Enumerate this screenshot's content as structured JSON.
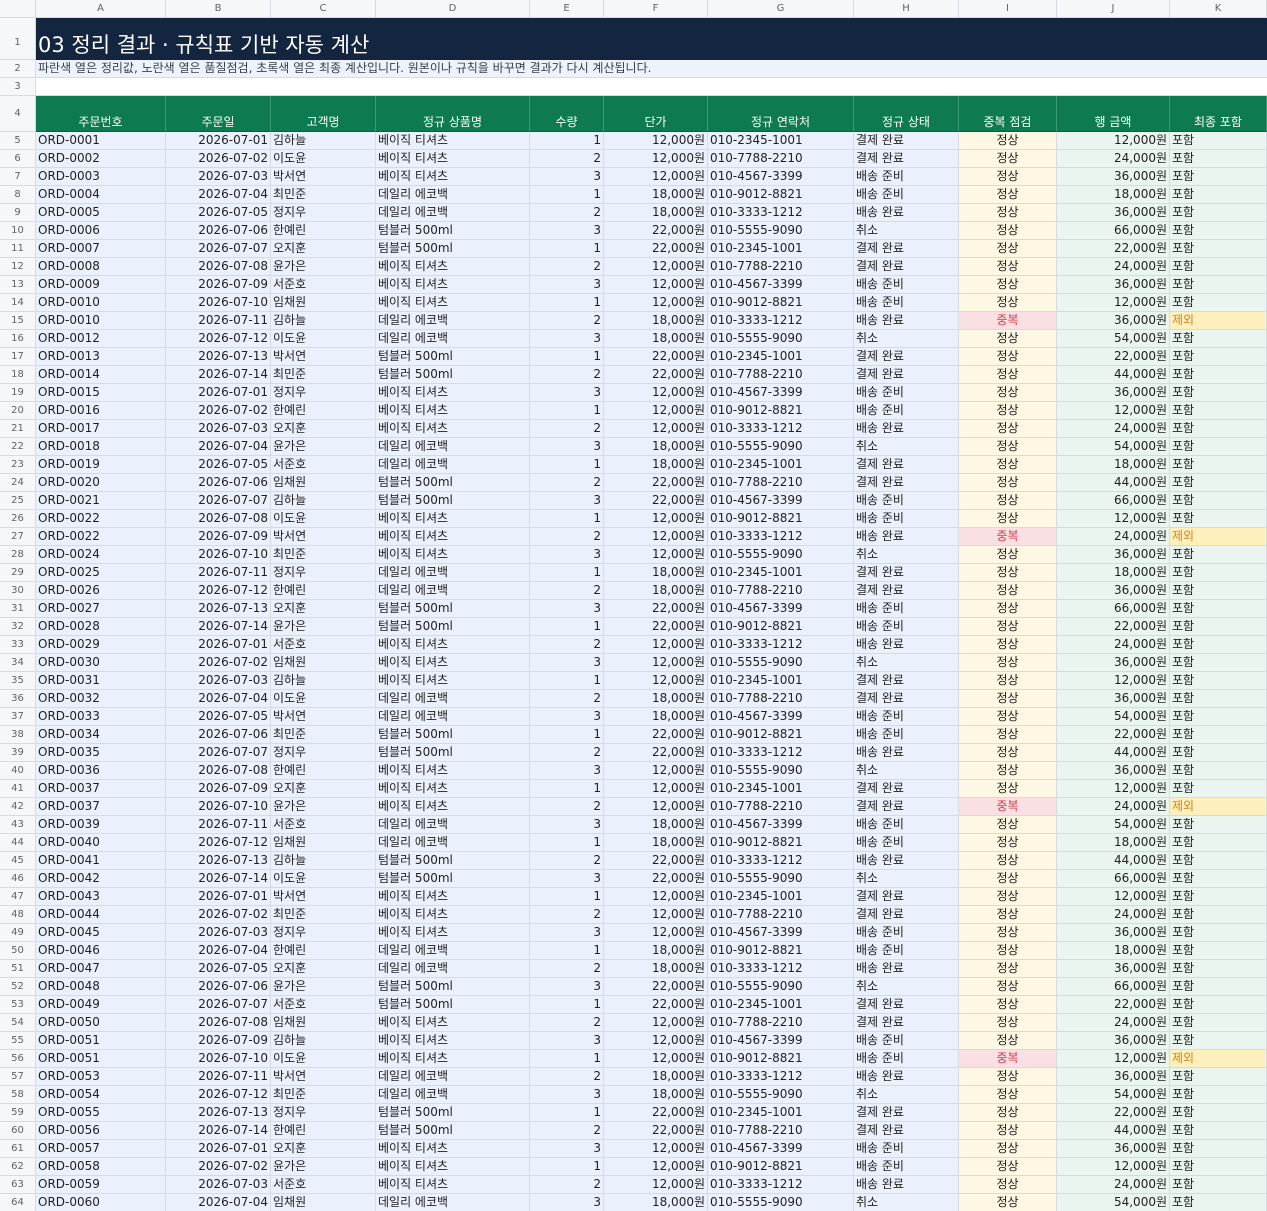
{
  "columns": [
    "A",
    "B",
    "C",
    "D",
    "E",
    "F",
    "G",
    "H",
    "I",
    "J",
    "K"
  ],
  "title": "03 정리 결과 · 규칙표 기반 자동 계산",
  "subtitle": "파란색 열은 정리값, 노란색 열은 품질점검, 초록색 열은 최종 계산입니다. 원본이나 규칙을 바꾸면 결과가 다시 계산됩니다.",
  "headers": [
    "주문번호",
    "주문일",
    "고객명",
    "정규 상품명",
    "수량",
    "단가",
    "정규 연락처",
    "정규 상태",
    "중복 점검",
    "행 금액",
    "최종 포함"
  ],
  "colors": {
    "title_bg": "#142540",
    "header_bg": "#0e7a4f",
    "clean_col": "#eaf1fc",
    "quality_col": "#fdf7e4",
    "final_col": "#e9f5ee",
    "dup_bg": "#fbe0e3",
    "dup_text": "#d23a4a",
    "excluded_bg": "#fdf0bd",
    "excluded_text": "#d5841a"
  },
  "rows": [
    {
      "order": "ORD-0001",
      "date": "2026-07-01",
      "customer": "김하늘",
      "product": "베이직 티셔츠",
      "qty": "1",
      "price": "12,000원",
      "phone": "010-2345-1001",
      "status": "결제 완료",
      "dup": "정상",
      "amount": "12,000원",
      "include": "포함"
    },
    {
      "order": "ORD-0002",
      "date": "2026-07-02",
      "customer": "이도윤",
      "product": "베이직 티셔츠",
      "qty": "2",
      "price": "12,000원",
      "phone": "010-7788-2210",
      "status": "결제 완료",
      "dup": "정상",
      "amount": "24,000원",
      "include": "포함"
    },
    {
      "order": "ORD-0003",
      "date": "2026-07-03",
      "customer": "박서연",
      "product": "베이직 티셔츠",
      "qty": "3",
      "price": "12,000원",
      "phone": "010-4567-3399",
      "status": "배송 준비",
      "dup": "정상",
      "amount": "36,000원",
      "include": "포함"
    },
    {
      "order": "ORD-0004",
      "date": "2026-07-04",
      "customer": "최민준",
      "product": "데일리 에코백",
      "qty": "1",
      "price": "18,000원",
      "phone": "010-9012-8821",
      "status": "배송 준비",
      "dup": "정상",
      "amount": "18,000원",
      "include": "포함"
    },
    {
      "order": "ORD-0005",
      "date": "2026-07-05",
      "customer": "정지우",
      "product": "데일리 에코백",
      "qty": "2",
      "price": "18,000원",
      "phone": "010-3333-1212",
      "status": "배송 완료",
      "dup": "정상",
      "amount": "36,000원",
      "include": "포함"
    },
    {
      "order": "ORD-0006",
      "date": "2026-07-06",
      "customer": "한예린",
      "product": "텀블러 500ml",
      "qty": "3",
      "price": "22,000원",
      "phone": "010-5555-9090",
      "status": "취소",
      "dup": "정상",
      "amount": "66,000원",
      "include": "포함"
    },
    {
      "order": "ORD-0007",
      "date": "2026-07-07",
      "customer": "오지훈",
      "product": "텀블러 500ml",
      "qty": "1",
      "price": "22,000원",
      "phone": "010-2345-1001",
      "status": "결제 완료",
      "dup": "정상",
      "amount": "22,000원",
      "include": "포함"
    },
    {
      "order": "ORD-0008",
      "date": "2026-07-08",
      "customer": "윤가은",
      "product": "베이직 티셔츠",
      "qty": "2",
      "price": "12,000원",
      "phone": "010-7788-2210",
      "status": "결제 완료",
      "dup": "정상",
      "amount": "24,000원",
      "include": "포함"
    },
    {
      "order": "ORD-0009",
      "date": "2026-07-09",
      "customer": "서준호",
      "product": "베이직 티셔츠",
      "qty": "3",
      "price": "12,000원",
      "phone": "010-4567-3399",
      "status": "배송 준비",
      "dup": "정상",
      "amount": "36,000원",
      "include": "포함"
    },
    {
      "order": "ORD-0010",
      "date": "2026-07-10",
      "customer": "임채원",
      "product": "베이직 티셔츠",
      "qty": "1",
      "price": "12,000원",
      "phone": "010-9012-8821",
      "status": "배송 준비",
      "dup": "정상",
      "amount": "12,000원",
      "include": "포함"
    },
    {
      "order": "ORD-0010",
      "date": "2026-07-11",
      "customer": "김하늘",
      "product": "데일리 에코백",
      "qty": "2",
      "price": "18,000원",
      "phone": "010-3333-1212",
      "status": "배송 완료",
      "dup": "중복",
      "amount": "36,000원",
      "include": "제외"
    },
    {
      "order": "ORD-0012",
      "date": "2026-07-12",
      "customer": "이도윤",
      "product": "데일리 에코백",
      "qty": "3",
      "price": "18,000원",
      "phone": "010-5555-9090",
      "status": "취소",
      "dup": "정상",
      "amount": "54,000원",
      "include": "포함"
    },
    {
      "order": "ORD-0013",
      "date": "2026-07-13",
      "customer": "박서연",
      "product": "텀블러 500ml",
      "qty": "1",
      "price": "22,000원",
      "phone": "010-2345-1001",
      "status": "결제 완료",
      "dup": "정상",
      "amount": "22,000원",
      "include": "포함"
    },
    {
      "order": "ORD-0014",
      "date": "2026-07-14",
      "customer": "최민준",
      "product": "텀블러 500ml",
      "qty": "2",
      "price": "22,000원",
      "phone": "010-7788-2210",
      "status": "결제 완료",
      "dup": "정상",
      "amount": "44,000원",
      "include": "포함"
    },
    {
      "order": "ORD-0015",
      "date": "2026-07-01",
      "customer": "정지우",
      "product": "베이직 티셔츠",
      "qty": "3",
      "price": "12,000원",
      "phone": "010-4567-3399",
      "status": "배송 준비",
      "dup": "정상",
      "amount": "36,000원",
      "include": "포함"
    },
    {
      "order": "ORD-0016",
      "date": "2026-07-02",
      "customer": "한예린",
      "product": "베이직 티셔츠",
      "qty": "1",
      "price": "12,000원",
      "phone": "010-9012-8821",
      "status": "배송 준비",
      "dup": "정상",
      "amount": "12,000원",
      "include": "포함"
    },
    {
      "order": "ORD-0017",
      "date": "2026-07-03",
      "customer": "오지훈",
      "product": "베이직 티셔츠",
      "qty": "2",
      "price": "12,000원",
      "phone": "010-3333-1212",
      "status": "배송 완료",
      "dup": "정상",
      "amount": "24,000원",
      "include": "포함"
    },
    {
      "order": "ORD-0018",
      "date": "2026-07-04",
      "customer": "윤가은",
      "product": "데일리 에코백",
      "qty": "3",
      "price": "18,000원",
      "phone": "010-5555-9090",
      "status": "취소",
      "dup": "정상",
      "amount": "54,000원",
      "include": "포함"
    },
    {
      "order": "ORD-0019",
      "date": "2026-07-05",
      "customer": "서준호",
      "product": "데일리 에코백",
      "qty": "1",
      "price": "18,000원",
      "phone": "010-2345-1001",
      "status": "결제 완료",
      "dup": "정상",
      "amount": "18,000원",
      "include": "포함"
    },
    {
      "order": "ORD-0020",
      "date": "2026-07-06",
      "customer": "임채원",
      "product": "텀블러 500ml",
      "qty": "2",
      "price": "22,000원",
      "phone": "010-7788-2210",
      "status": "결제 완료",
      "dup": "정상",
      "amount": "44,000원",
      "include": "포함"
    },
    {
      "order": "ORD-0021",
      "date": "2026-07-07",
      "customer": "김하늘",
      "product": "텀블러 500ml",
      "qty": "3",
      "price": "22,000원",
      "phone": "010-4567-3399",
      "status": "배송 준비",
      "dup": "정상",
      "amount": "66,000원",
      "include": "포함"
    },
    {
      "order": "ORD-0022",
      "date": "2026-07-08",
      "customer": "이도윤",
      "product": "베이직 티셔츠",
      "qty": "1",
      "price": "12,000원",
      "phone": "010-9012-8821",
      "status": "배송 준비",
      "dup": "정상",
      "amount": "12,000원",
      "include": "포함"
    },
    {
      "order": "ORD-0022",
      "date": "2026-07-09",
      "customer": "박서연",
      "product": "베이직 티셔츠",
      "qty": "2",
      "price": "12,000원",
      "phone": "010-3333-1212",
      "status": "배송 완료",
      "dup": "중복",
      "amount": "24,000원",
      "include": "제외"
    },
    {
      "order": "ORD-0024",
      "date": "2026-07-10",
      "customer": "최민준",
      "product": "베이직 티셔츠",
      "qty": "3",
      "price": "12,000원",
      "phone": "010-5555-9090",
      "status": "취소",
      "dup": "정상",
      "amount": "36,000원",
      "include": "포함"
    },
    {
      "order": "ORD-0025",
      "date": "2026-07-11",
      "customer": "정지우",
      "product": "데일리 에코백",
      "qty": "1",
      "price": "18,000원",
      "phone": "010-2345-1001",
      "status": "결제 완료",
      "dup": "정상",
      "amount": "18,000원",
      "include": "포함"
    },
    {
      "order": "ORD-0026",
      "date": "2026-07-12",
      "customer": "한예린",
      "product": "데일리 에코백",
      "qty": "2",
      "price": "18,000원",
      "phone": "010-7788-2210",
      "status": "결제 완료",
      "dup": "정상",
      "amount": "36,000원",
      "include": "포함"
    },
    {
      "order": "ORD-0027",
      "date": "2026-07-13",
      "customer": "오지훈",
      "product": "텀블러 500ml",
      "qty": "3",
      "price": "22,000원",
      "phone": "010-4567-3399",
      "status": "배송 준비",
      "dup": "정상",
      "amount": "66,000원",
      "include": "포함"
    },
    {
      "order": "ORD-0028",
      "date": "2026-07-14",
      "customer": "윤가은",
      "product": "텀블러 500ml",
      "qty": "1",
      "price": "22,000원",
      "phone": "010-9012-8821",
      "status": "배송 준비",
      "dup": "정상",
      "amount": "22,000원",
      "include": "포함"
    },
    {
      "order": "ORD-0029",
      "date": "2026-07-01",
      "customer": "서준호",
      "product": "베이직 티셔츠",
      "qty": "2",
      "price": "12,000원",
      "phone": "010-3333-1212",
      "status": "배송 완료",
      "dup": "정상",
      "amount": "24,000원",
      "include": "포함"
    },
    {
      "order": "ORD-0030",
      "date": "2026-07-02",
      "customer": "임채원",
      "product": "베이직 티셔츠",
      "qty": "3",
      "price": "12,000원",
      "phone": "010-5555-9090",
      "status": "취소",
      "dup": "정상",
      "amount": "36,000원",
      "include": "포함"
    },
    {
      "order": "ORD-0031",
      "date": "2026-07-03",
      "customer": "김하늘",
      "product": "베이직 티셔츠",
      "qty": "1",
      "price": "12,000원",
      "phone": "010-2345-1001",
      "status": "결제 완료",
      "dup": "정상",
      "amount": "12,000원",
      "include": "포함"
    },
    {
      "order": "ORD-0032",
      "date": "2026-07-04",
      "customer": "이도윤",
      "product": "데일리 에코백",
      "qty": "2",
      "price": "18,000원",
      "phone": "010-7788-2210",
      "status": "결제 완료",
      "dup": "정상",
      "amount": "36,000원",
      "include": "포함"
    },
    {
      "order": "ORD-0033",
      "date": "2026-07-05",
      "customer": "박서연",
      "product": "데일리 에코백",
      "qty": "3",
      "price": "18,000원",
      "phone": "010-4567-3399",
      "status": "배송 준비",
      "dup": "정상",
      "amount": "54,000원",
      "include": "포함"
    },
    {
      "order": "ORD-0034",
      "date": "2026-07-06",
      "customer": "최민준",
      "product": "텀블러 500ml",
      "qty": "1",
      "price": "22,000원",
      "phone": "010-9012-8821",
      "status": "배송 준비",
      "dup": "정상",
      "amount": "22,000원",
      "include": "포함"
    },
    {
      "order": "ORD-0035",
      "date": "2026-07-07",
      "customer": "정지우",
      "product": "텀블러 500ml",
      "qty": "2",
      "price": "22,000원",
      "phone": "010-3333-1212",
      "status": "배송 완료",
      "dup": "정상",
      "amount": "44,000원",
      "include": "포함"
    },
    {
      "order": "ORD-0036",
      "date": "2026-07-08",
      "customer": "한예린",
      "product": "베이직 티셔츠",
      "qty": "3",
      "price": "12,000원",
      "phone": "010-5555-9090",
      "status": "취소",
      "dup": "정상",
      "amount": "36,000원",
      "include": "포함"
    },
    {
      "order": "ORD-0037",
      "date": "2026-07-09",
      "customer": "오지훈",
      "product": "베이직 티셔츠",
      "qty": "1",
      "price": "12,000원",
      "phone": "010-2345-1001",
      "status": "결제 완료",
      "dup": "정상",
      "amount": "12,000원",
      "include": "포함"
    },
    {
      "order": "ORD-0037",
      "date": "2026-07-10",
      "customer": "윤가은",
      "product": "베이직 티셔츠",
      "qty": "2",
      "price": "12,000원",
      "phone": "010-7788-2210",
      "status": "결제 완료",
      "dup": "중복",
      "amount": "24,000원",
      "include": "제외"
    },
    {
      "order": "ORD-0039",
      "date": "2026-07-11",
      "customer": "서준호",
      "product": "데일리 에코백",
      "qty": "3",
      "price": "18,000원",
      "phone": "010-4567-3399",
      "status": "배송 준비",
      "dup": "정상",
      "amount": "54,000원",
      "include": "포함"
    },
    {
      "order": "ORD-0040",
      "date": "2026-07-12",
      "customer": "임채원",
      "product": "데일리 에코백",
      "qty": "1",
      "price": "18,000원",
      "phone": "010-9012-8821",
      "status": "배송 준비",
      "dup": "정상",
      "amount": "18,000원",
      "include": "포함"
    },
    {
      "order": "ORD-0041",
      "date": "2026-07-13",
      "customer": "김하늘",
      "product": "텀블러 500ml",
      "qty": "2",
      "price": "22,000원",
      "phone": "010-3333-1212",
      "status": "배송 완료",
      "dup": "정상",
      "amount": "44,000원",
      "include": "포함"
    },
    {
      "order": "ORD-0042",
      "date": "2026-07-14",
      "customer": "이도윤",
      "product": "텀블러 500ml",
      "qty": "3",
      "price": "22,000원",
      "phone": "010-5555-9090",
      "status": "취소",
      "dup": "정상",
      "amount": "66,000원",
      "include": "포함"
    },
    {
      "order": "ORD-0043",
      "date": "2026-07-01",
      "customer": "박서연",
      "product": "베이직 티셔츠",
      "qty": "1",
      "price": "12,000원",
      "phone": "010-2345-1001",
      "status": "결제 완료",
      "dup": "정상",
      "amount": "12,000원",
      "include": "포함"
    },
    {
      "order": "ORD-0044",
      "date": "2026-07-02",
      "customer": "최민준",
      "product": "베이직 티셔츠",
      "qty": "2",
      "price": "12,000원",
      "phone": "010-7788-2210",
      "status": "결제 완료",
      "dup": "정상",
      "amount": "24,000원",
      "include": "포함"
    },
    {
      "order": "ORD-0045",
      "date": "2026-07-03",
      "customer": "정지우",
      "product": "베이직 티셔츠",
      "qty": "3",
      "price": "12,000원",
      "phone": "010-4567-3399",
      "status": "배송 준비",
      "dup": "정상",
      "amount": "36,000원",
      "include": "포함"
    },
    {
      "order": "ORD-0046",
      "date": "2026-07-04",
      "customer": "한예린",
      "product": "데일리 에코백",
      "qty": "1",
      "price": "18,000원",
      "phone": "010-9012-8821",
      "status": "배송 준비",
      "dup": "정상",
      "amount": "18,000원",
      "include": "포함"
    },
    {
      "order": "ORD-0047",
      "date": "2026-07-05",
      "customer": "오지훈",
      "product": "데일리 에코백",
      "qty": "2",
      "price": "18,000원",
      "phone": "010-3333-1212",
      "status": "배송 완료",
      "dup": "정상",
      "amount": "36,000원",
      "include": "포함"
    },
    {
      "order": "ORD-0048",
      "date": "2026-07-06",
      "customer": "윤가은",
      "product": "텀블러 500ml",
      "qty": "3",
      "price": "22,000원",
      "phone": "010-5555-9090",
      "status": "취소",
      "dup": "정상",
      "amount": "66,000원",
      "include": "포함"
    },
    {
      "order": "ORD-0049",
      "date": "2026-07-07",
      "customer": "서준호",
      "product": "텀블러 500ml",
      "qty": "1",
      "price": "22,000원",
      "phone": "010-2345-1001",
      "status": "결제 완료",
      "dup": "정상",
      "amount": "22,000원",
      "include": "포함"
    },
    {
      "order": "ORD-0050",
      "date": "2026-07-08",
      "customer": "임채원",
      "product": "베이직 티셔츠",
      "qty": "2",
      "price": "12,000원",
      "phone": "010-7788-2210",
      "status": "결제 완료",
      "dup": "정상",
      "amount": "24,000원",
      "include": "포함"
    },
    {
      "order": "ORD-0051",
      "date": "2026-07-09",
      "customer": "김하늘",
      "product": "베이직 티셔츠",
      "qty": "3",
      "price": "12,000원",
      "phone": "010-4567-3399",
      "status": "배송 준비",
      "dup": "정상",
      "amount": "36,000원",
      "include": "포함"
    },
    {
      "order": "ORD-0051",
      "date": "2026-07-10",
      "customer": "이도윤",
      "product": "베이직 티셔츠",
      "qty": "1",
      "price": "12,000원",
      "phone": "010-9012-8821",
      "status": "배송 준비",
      "dup": "중복",
      "amount": "12,000원",
      "include": "제외"
    },
    {
      "order": "ORD-0053",
      "date": "2026-07-11",
      "customer": "박서연",
      "product": "데일리 에코백",
      "qty": "2",
      "price": "18,000원",
      "phone": "010-3333-1212",
      "status": "배송 완료",
      "dup": "정상",
      "amount": "36,000원",
      "include": "포함"
    },
    {
      "order": "ORD-0054",
      "date": "2026-07-12",
      "customer": "최민준",
      "product": "데일리 에코백",
      "qty": "3",
      "price": "18,000원",
      "phone": "010-5555-9090",
      "status": "취소",
      "dup": "정상",
      "amount": "54,000원",
      "include": "포함"
    },
    {
      "order": "ORD-0055",
      "date": "2026-07-13",
      "customer": "정지우",
      "product": "텀블러 500ml",
      "qty": "1",
      "price": "22,000원",
      "phone": "010-2345-1001",
      "status": "결제 완료",
      "dup": "정상",
      "amount": "22,000원",
      "include": "포함"
    },
    {
      "order": "ORD-0056",
      "date": "2026-07-14",
      "customer": "한예린",
      "product": "텀블러 500ml",
      "qty": "2",
      "price": "22,000원",
      "phone": "010-7788-2210",
      "status": "결제 완료",
      "dup": "정상",
      "amount": "44,000원",
      "include": "포함"
    },
    {
      "order": "ORD-0057",
      "date": "2026-07-01",
      "customer": "오지훈",
      "product": "베이직 티셔츠",
      "qty": "3",
      "price": "12,000원",
      "phone": "010-4567-3399",
      "status": "배송 준비",
      "dup": "정상",
      "amount": "36,000원",
      "include": "포함"
    },
    {
      "order": "ORD-0058",
      "date": "2026-07-02",
      "customer": "윤가은",
      "product": "베이직 티셔츠",
      "qty": "1",
      "price": "12,000원",
      "phone": "010-9012-8821",
      "status": "배송 준비",
      "dup": "정상",
      "amount": "12,000원",
      "include": "포함"
    },
    {
      "order": "ORD-0059",
      "date": "2026-07-03",
      "customer": "서준호",
      "product": "베이직 티셔츠",
      "qty": "2",
      "price": "12,000원",
      "phone": "010-3333-1212",
      "status": "배송 완료",
      "dup": "정상",
      "amount": "24,000원",
      "include": "포함"
    },
    {
      "order": "ORD-0060",
      "date": "2026-07-04",
      "customer": "임채원",
      "product": "데일리 에코백",
      "qty": "3",
      "price": "18,000원",
      "phone": "010-5555-9090",
      "status": "취소",
      "dup": "정상",
      "amount": "54,000원",
      "include": "포함"
    }
  ]
}
